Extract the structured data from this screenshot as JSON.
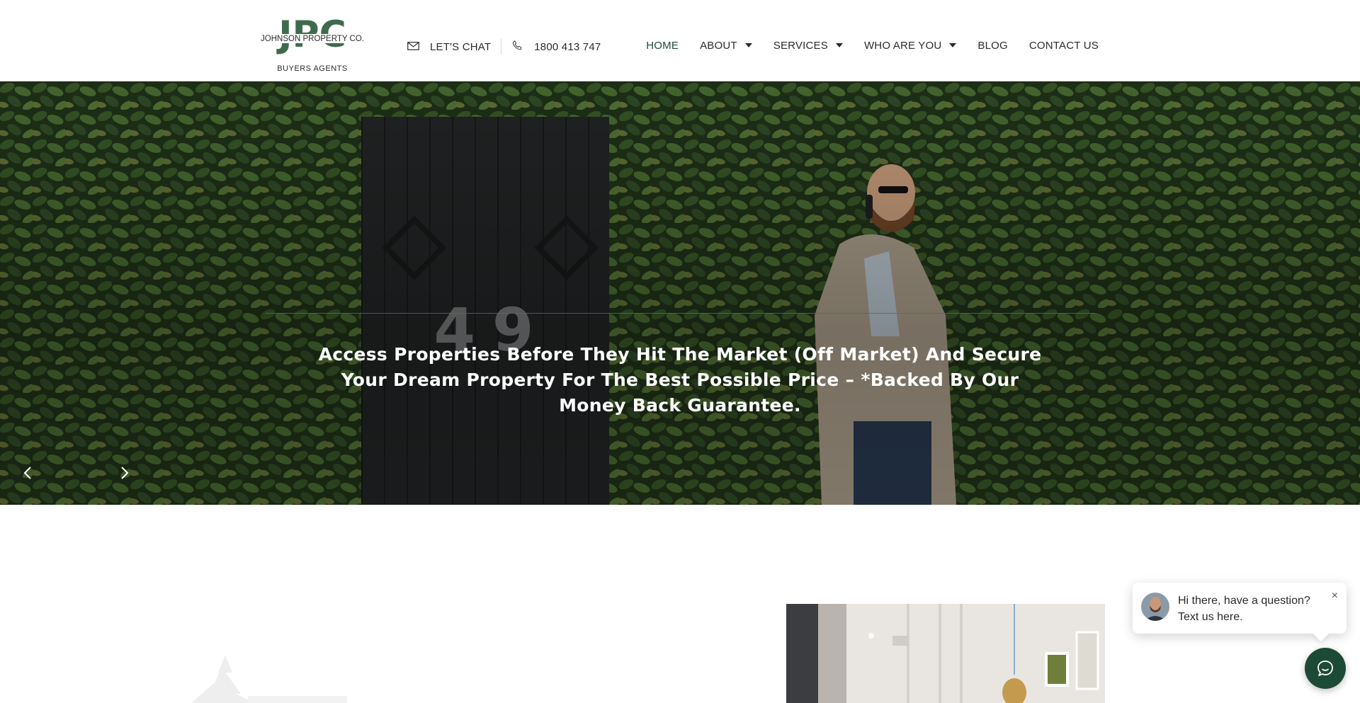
{
  "header": {
    "logo": {
      "wordmark": "JPC",
      "company": "JOHNSON PROPERTY CO.",
      "tagline": "BUYERS AGENTS"
    },
    "contact": {
      "chat_icon": "envelope-icon",
      "chat_label": "LET'S CHAT",
      "phone_icon": "phone-icon",
      "phone_label": "1800 413 747"
    },
    "nav": [
      {
        "label": "HOME",
        "active": true
      },
      {
        "label": "ABOUT",
        "dropdown": true
      },
      {
        "label": "SERVICES",
        "dropdown": true
      },
      {
        "label": "WHO ARE YOU",
        "dropdown": true
      },
      {
        "label": "BLOG"
      },
      {
        "label": "CONTACT US"
      }
    ]
  },
  "hero": {
    "house_number": "49",
    "headline": "Access Properties Before They Hit The Market (Off Market) And Secure Your Dream Property For The Best Possible Price – *Backed By Our Money Back Guarantee.",
    "prev_icon": "chevron-left-icon",
    "next_icon": "chevron-right-icon"
  },
  "chat_widget": {
    "message": "Hi there, have a question? Text us here.",
    "close_label": "×",
    "launcher_icon": "chat-icon"
  },
  "colors": {
    "brand_green": "#1d4a37",
    "logo_green": "#3e6b4f",
    "text_dark": "#2b2b2b"
  }
}
